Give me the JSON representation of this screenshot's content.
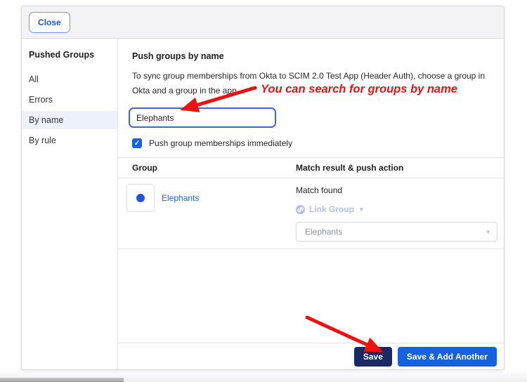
{
  "modal": {
    "close_label": "Close"
  },
  "sidebar": {
    "title": "Pushed Groups",
    "items": [
      {
        "label": "All",
        "selected": false
      },
      {
        "label": "Errors",
        "selected": false
      },
      {
        "label": "By name",
        "selected": true
      },
      {
        "label": "By rule",
        "selected": false
      }
    ]
  },
  "main": {
    "heading": "Push groups by name",
    "description": "To sync group memberships from Okta to SCIM 2.0 Test App (Header Auth), choose a group in Okta and a group in the app.",
    "search": {
      "value": "Elephants",
      "focused": true
    },
    "checkbox": {
      "label": "Push group memberships immediately",
      "checked": true
    },
    "table": {
      "columns": [
        "Group",
        "Match result & push action"
      ],
      "row": {
        "group_name": "Elephants",
        "match_status": "Match found",
        "push_action": "Link Group",
        "app_group_value": "Elephants"
      }
    },
    "buttons": {
      "save": "Save",
      "save_add": "Save & Add Another"
    }
  },
  "annotations": {
    "search_note": "You can search for groups by name"
  },
  "icons": {
    "checkmark": "✓",
    "caret_down": "▾"
  },
  "colors": {
    "accent_blue": "#1662dd",
    "save_navy": "#182963",
    "selected_item_bg": "#ecf1fa",
    "disabled_lavender": "#b2bef2",
    "annotation_red": "#ee1111",
    "okta_logo_blue": "#2553dc"
  }
}
